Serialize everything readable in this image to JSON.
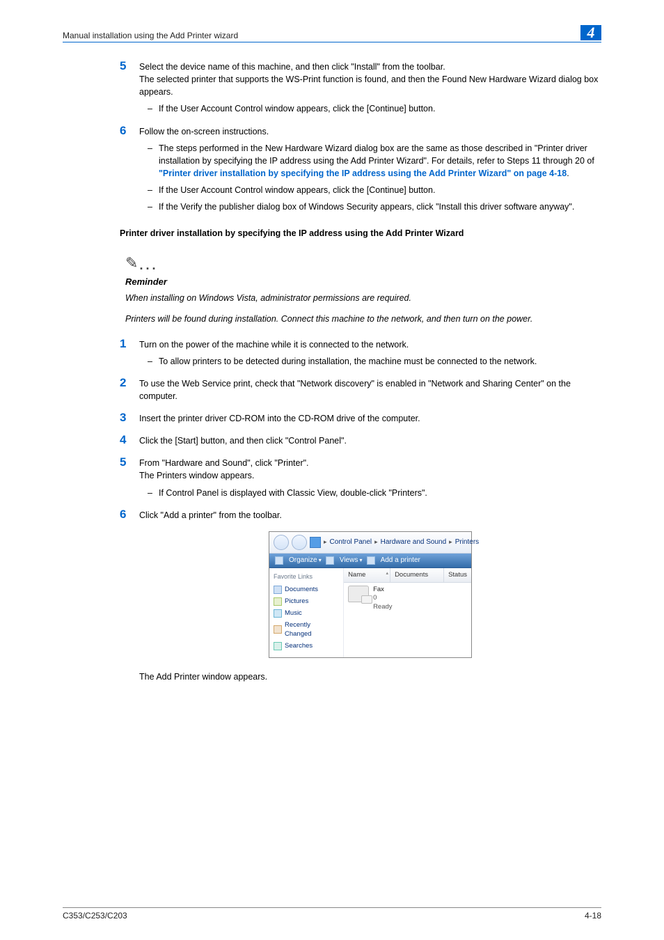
{
  "header": {
    "title": "Manual installation using the Add Printer wizard",
    "chapter": "4"
  },
  "steps_a": [
    {
      "num": "5",
      "text": "Select the device name of this machine, and then click \"Install\" from the toolbar.",
      "text2": "The selected printer that supports the WS-Print function is found, and then the Found New Hardware Wizard dialog box appears.",
      "bullets": [
        "If the User Account Control window appears, click the [Continue] button."
      ]
    },
    {
      "num": "6",
      "text": "Follow the on-screen instructions.",
      "bullets_pre": "The steps performed in the New Hardware Wizard dialog box are the same as those described in \"Printer driver installation by specifying the IP address using the Add Printer Wizard\". For details, refer to Steps 11 through 20 of ",
      "link": "\"Printer driver installation by specifying the IP address using the Add Printer Wizard\" on page 4-18",
      "bullets_post": ".",
      "bullets_extra": [
        "If the User Account Control window appears, click the [Continue] button.",
        "If the Verify the publisher dialog box of Windows Security appears, click \"Install this driver software anyway\"."
      ]
    }
  ],
  "section_heading": "Printer driver installation by specifying the IP address using the Add Printer Wizard",
  "reminder": {
    "label": "Reminder",
    "line1": "When installing on Windows Vista, administrator permissions are required.",
    "line2": "Printers will be found during installation. Connect this machine to the network, and then turn on the power."
  },
  "steps_b": [
    {
      "num": "1",
      "text": "Turn on the power of the machine while it is connected to the network.",
      "bullets": [
        "To allow printers to be detected during installation, the machine must be connected to the network."
      ]
    },
    {
      "num": "2",
      "text": "To use the Web Service print, check that \"Network discovery\" is enabled in \"Network and Sharing Center\" on the computer."
    },
    {
      "num": "3",
      "text": "Insert the printer driver CD-ROM into the CD-ROM drive of the computer."
    },
    {
      "num": "4",
      "text": "Click the [Start] button, and then click \"Control Panel\"."
    },
    {
      "num": "5",
      "text": "From \"Hardware and Sound\", click \"Printer\".",
      "text2": "The Printers window appears.",
      "bullets": [
        "If Control Panel is displayed with Classic View, double-click \"Printers\"."
      ]
    },
    {
      "num": "6",
      "text": "Click \"Add a printer\" from the toolbar."
    }
  ],
  "screenshot": {
    "breadcrumb": [
      "Control Panel",
      "Hardware and Sound",
      "Printers"
    ],
    "toolbar": {
      "organize": "Organize",
      "views": "Views",
      "add": "Add a printer"
    },
    "sidebar": {
      "title": "Favorite Links",
      "items": [
        "Documents",
        "Pictures",
        "Music",
        "Recently Changed",
        "Searches"
      ]
    },
    "columns": [
      "Name",
      "Documents",
      "Status"
    ],
    "fax": {
      "name": "Fax",
      "count": "0",
      "status": "Ready"
    }
  },
  "after_screenshot": "The Add Printer window appears.",
  "footer": {
    "left": "C353/C253/C203",
    "right": "4-18"
  }
}
